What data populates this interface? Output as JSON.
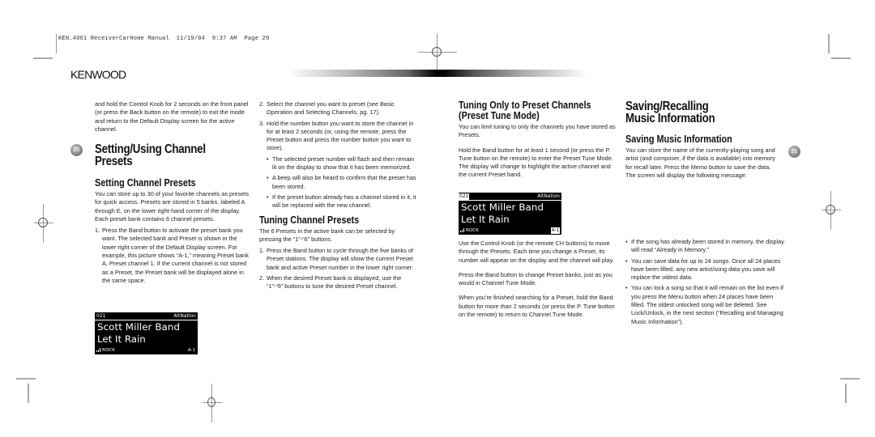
{
  "slug": "KEN.4061 ReceiverCarHome Manual  11/19/04  9:37 AM  Page 20",
  "brand": "KENWOOD",
  "left_page": {
    "page_number": "20",
    "intro_para": "and hold the Control Knob for 2 seconds on the front panel (or press the Back button on the remote) to exit the mode and return to the Default Display screen for the active channel.",
    "section_title_line1": "Setting/Using Channel",
    "section_title_line2": "Presets",
    "setting_heading": "Setting Channel Presets",
    "setting_para": "You can store up to 30 of your favorite channels as presets for quick access. Presets are stored in 5 banks, labeled A through E, on the lower right-hand corner of the display. Each preset bank contains 6 channel presets.",
    "setting_steps": [
      {
        "num": "1.",
        "text": "Press the Band button to activate the preset bank you want. The selected bank and Preset is shown in the lower right corner of the Default Display screen. For example, this picture shows “A-1,” meaning Preset bank A, Preset channel 1. If the current channel is not stored as a Preset, the Preset bank will be displayed alone in the same space."
      },
      {
        "num": "2.",
        "text": "Select the channel you want to preset (see Basic Operation and Selecting Channels, pg. 17)."
      },
      {
        "num": "3.",
        "text": "Hold the number button you want to store the channel in for at least 2 seconds (or, using the remote, press the Preset button and press the number button you want to store)."
      }
    ],
    "step3_bullets": [
      "The selected preset number will flash and then remain lit on the display to show that it has been memorized.",
      "A beep will also be heard to confirm that the preset has been stored.",
      "If the preset button already has a channel stored in it, it will be replaced with the new channel."
    ],
    "display1": {
      "channel": "021",
      "channel_name": "AltNation",
      "artist": "Scott Miller Band",
      "song": "Let It Rain",
      "category": "ROCK",
      "preset": "A-1"
    },
    "tuning_heading": "Tuning Channel Presets",
    "tuning_para": "The 6 Presets in the active bank can be selected by pressing the “1”-“6” buttons.",
    "tuning_steps": [
      {
        "num": "1.",
        "text": "Press the Band button to cycle through the five banks of Preset stations. The display will show the current Preset bank and active Preset number in the lower right corner."
      },
      {
        "num": "2.",
        "text": "When the desired Preset bank is displayed, use the “1”-“6” buttons to tune the desired Preset channel."
      }
    ]
  },
  "right_page": {
    "page_number": "21",
    "preset_tune_heading_line1": "Tuning Only to Preset Channels",
    "preset_tune_heading_line2": "(Preset Tune Mode)",
    "preset_tune_para1": "You can limit tuning to only the channels you have stored as Presets.",
    "preset_tune_para2": "Hold the Band button for at least 1 second (or press the P. Tune button on the remote) to enter the Preset Tune Mode. The display will change to highlight the active channel and the current Preset band.",
    "display2": {
      "channel": "021",
      "channel_name": "AltNation",
      "artist": "Scott Miller Band",
      "song": "Let It Rain",
      "category": "ROCK",
      "preset": "A-1"
    },
    "preset_tune_para3": "Use the Control Knob (or the remote CH buttons) to move through the Presets. Each time you change a Preset, its number will appear on the display and the channel will play.",
    "preset_tune_para4": "Press the Band button to change Preset banks, just as you would in Channel Tune Mode.",
    "preset_tune_para5": "When you’re finished searching for a Preset, hold the Band button for more than 2 seconds (or press the P. Tune button on the remote) to return to Channel Tune Mode.",
    "saving_title_line1": "Saving/Recalling",
    "saving_title_line2": "Music Information",
    "saving_heading": "Saving Music Information",
    "saving_para": "You can store the name of the currently-playing song and artist (and composer, if the data is available) into memory for recall later. Press the Memo button to save the data. The screen will display the following message:",
    "saving_bullets": [
      "If the song has already been stored in memory, the display will read “Already in Memory.”",
      "You can save data for up to 24 songs. Once all 24 places have been filled, any new artist/song data you save will replace the oldest data.",
      "You can lock a song so that it will remain on the list even if you press the Menu button when 24 places have been filled. The oldest unlocked song will be deleted. See Lock/Unlock, in the next section (“Recalling and Managing Music Information”)."
    ]
  }
}
